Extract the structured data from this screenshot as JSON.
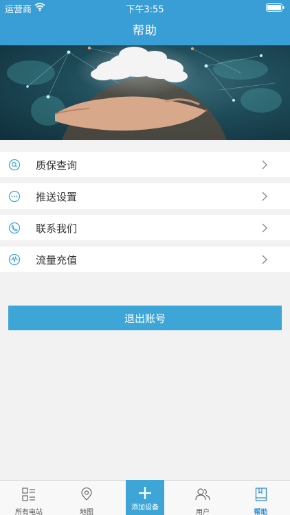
{
  "status_bar": {
    "carrier": "运营商",
    "time": "下午3:55"
  },
  "nav": {
    "title": "帮助"
  },
  "menu": [
    {
      "label": "质保查询",
      "icon": "search-icon"
    },
    {
      "label": "推送设置",
      "icon": "more-dots-icon"
    },
    {
      "label": "联系我们",
      "icon": "phone-icon"
    },
    {
      "label": "流量充值",
      "icon": "signal-wave-icon"
    }
  ],
  "logout": {
    "label": "退出账号"
  },
  "tabbar": {
    "items": [
      {
        "label": "所有电站",
        "icon": "station-list-icon"
      },
      {
        "label": "地图",
        "icon": "map-pin-icon"
      },
      {
        "label": "添加设备",
        "icon": "plus-icon"
      },
      {
        "label": "用户",
        "icon": "users-icon"
      },
      {
        "label": "帮助",
        "icon": "book-icon"
      }
    ],
    "active_index": 4
  },
  "colors": {
    "primary": "#3a9ed6",
    "tab_active": "#2f8fd0",
    "background": "#f2f2f2"
  }
}
